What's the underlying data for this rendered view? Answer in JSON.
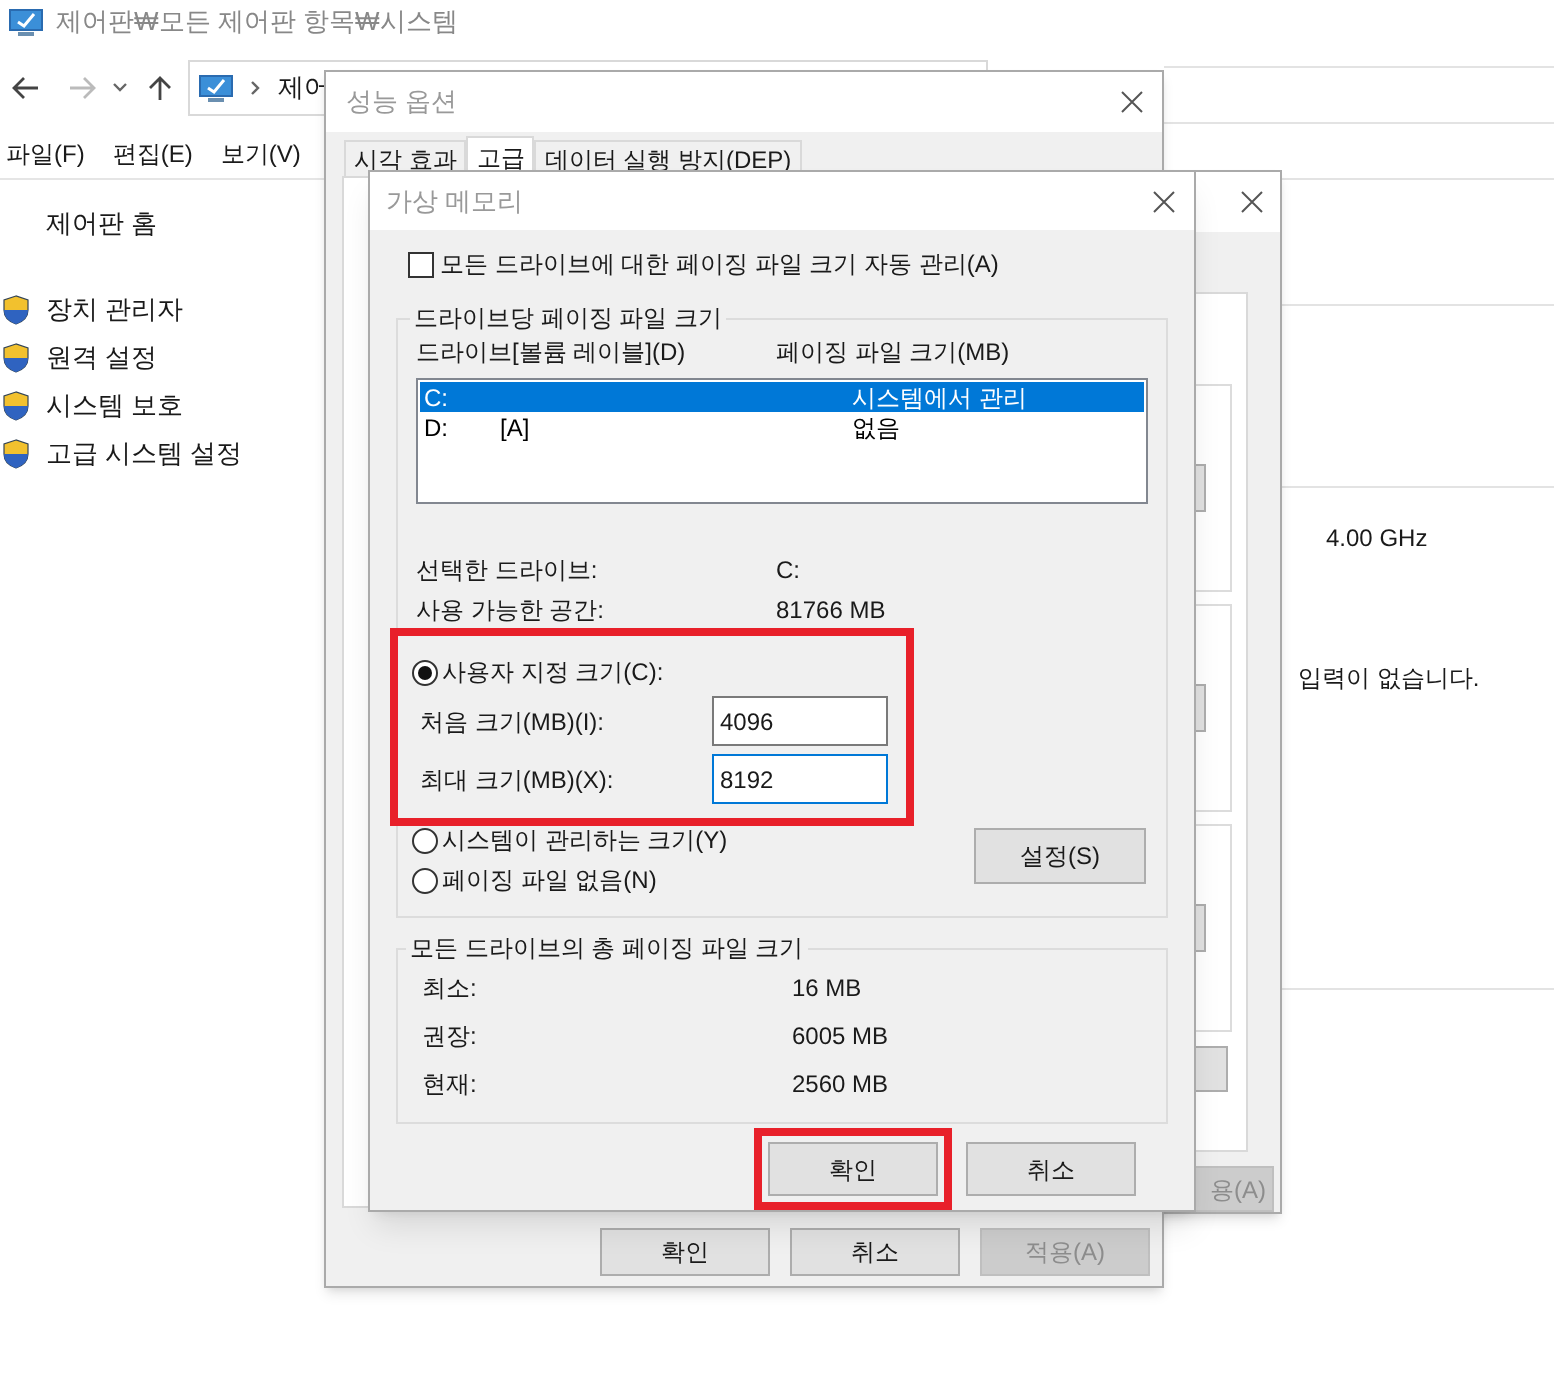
{
  "window": {
    "title": "제어판₩모든 제어판 항목₩시스템"
  },
  "address": {
    "text": "제어"
  },
  "menu": [
    {
      "label": "파일(F)"
    },
    {
      "label": "편집(E)"
    },
    {
      "label": "보기(V)"
    }
  ],
  "sidebar": {
    "home": "제어판 홈",
    "items": [
      {
        "label": "장치 관리자"
      },
      {
        "label": "원격 설정"
      },
      {
        "label": "시스템 보호"
      },
      {
        "label": "고급 시스템 설정"
      }
    ]
  },
  "main": {
    "processor_speed": "4.00 GHz",
    "pen_touch": "입력이 없습니다."
  },
  "system_properties": {
    "apply_button": {
      "label": "용(A)",
      "disabled": true
    }
  },
  "performance_options": {
    "title": "성능 옵션",
    "tabs": [
      {
        "label": "시각 효과",
        "selected": false
      },
      {
        "label": "고급",
        "selected": true
      },
      {
        "label": "데이터 실행 방지(DEP)",
        "selected": false
      }
    ],
    "buttons": [
      {
        "label": "확인",
        "disabled": false
      },
      {
        "label": "취소",
        "disabled": false
      },
      {
        "label": "적용(A)",
        "disabled": true
      }
    ]
  },
  "virtual_memory": {
    "title": "가상 메모리",
    "auto_manage": {
      "label": "모든 드라이브에 대한 페이징 파일 크기 자동 관리(A)",
      "checked": false
    },
    "per_drive": {
      "title": "드라이브당 페이징 파일 크기",
      "columns": [
        "드라이브[볼륨 레이블](D)",
        "페이징 파일 크기(MB)"
      ],
      "rows": [
        {
          "drive": "C:",
          "label": "",
          "size": "시스템에서 관리",
          "selected": true
        },
        {
          "drive": "D:",
          "label": "[A]",
          "size": "없음",
          "selected": false
        }
      ],
      "selected_drive": {
        "label": "선택한 드라이브:",
        "value": "C:"
      },
      "free_space": {
        "label": "사용 가능한 공간:",
        "value": "81766 MB"
      },
      "options": [
        {
          "kind": "custom",
          "label": "사용자 지정 크기(C):",
          "selected": true
        },
        {
          "kind": "system",
          "label": "시스템이 관리하는 크기(Y)",
          "selected": false
        },
        {
          "kind": "none",
          "label": "페이징 파일 없음(N)",
          "selected": false
        }
      ],
      "custom_size": {
        "highlighted": true,
        "initial": {
          "label": "처음 크기(MB)(I):",
          "value": "4096",
          "focused": false
        },
        "maximum": {
          "label": "최대 크기(MB)(X):",
          "value": "8192",
          "focused": true
        }
      },
      "set_button": "설정(S)"
    },
    "totals": {
      "title": "모든 드라이브의 총 페이징 파일 크기",
      "rows": [
        {
          "label": "최소:",
          "value": "16 MB"
        },
        {
          "label": "권장:",
          "value": "6005 MB"
        },
        {
          "label": "현재:",
          "value": "2560 MB"
        }
      ]
    },
    "buttons": [
      {
        "label": "확인",
        "highlighted": true
      },
      {
        "label": "취소",
        "highlighted": false
      }
    ]
  }
}
